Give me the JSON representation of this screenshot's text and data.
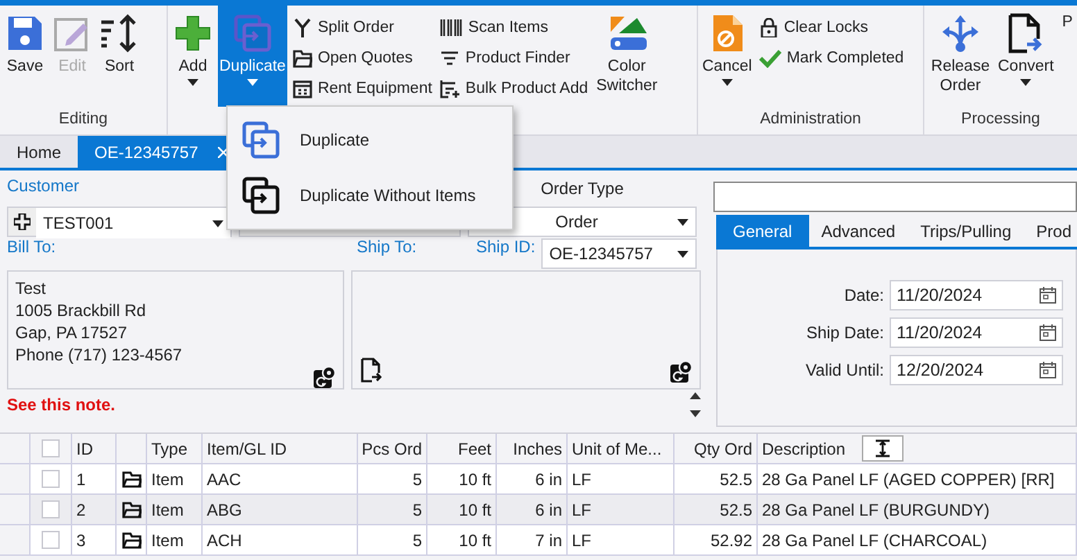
{
  "ribbon": {
    "groups": [
      {
        "label": "Editing",
        "items": [
          {
            "kind": "large",
            "label": "Save",
            "disabled": false,
            "dropdown": false,
            "open": false
          },
          {
            "kind": "large",
            "label": "Edit",
            "disabled": true,
            "dropdown": false,
            "open": false
          },
          {
            "kind": "large",
            "label": "Sort",
            "disabled": false,
            "dropdown": false,
            "open": false
          }
        ]
      },
      {
        "items": [
          {
            "kind": "large",
            "label": "Add",
            "disabled": false,
            "dropdown": true,
            "open": false
          },
          {
            "kind": "large",
            "label": "Duplicate",
            "disabled": false,
            "dropdown": true,
            "open": true
          },
          {
            "kind": "column",
            "items": [
              {
                "label": "Split Order"
              },
              {
                "label": "Open Quotes"
              },
              {
                "label": "Rent Equipment"
              }
            ]
          },
          {
            "kind": "column",
            "items": [
              {
                "label": "Scan Items"
              },
              {
                "label": "Product Finder"
              },
              {
                "label": "Bulk Product Add"
              }
            ]
          },
          {
            "kind": "large",
            "label": "Color Switcher",
            "disabled": false,
            "dropdown": false,
            "open": false
          }
        ]
      },
      {
        "label": "Administration",
        "items": [
          {
            "kind": "large",
            "label": "Cancel",
            "disabled": false,
            "dropdown": true,
            "open": false
          },
          {
            "kind": "column",
            "items": [
              {
                "label": "Clear Locks"
              },
              {
                "label": "Mark Completed"
              }
            ]
          }
        ]
      },
      {
        "label": "Processing",
        "items": [
          {
            "kind": "large",
            "label": "Release Order",
            "disabled": false,
            "dropdown": false,
            "open": false
          },
          {
            "kind": "large",
            "label": "Convert",
            "disabled": false,
            "dropdown": true,
            "open": false
          },
          {
            "kind": "large",
            "label": "P",
            "disabled": false,
            "dropdown": false,
            "open": false
          }
        ]
      }
    ]
  },
  "dropdown_menu": {
    "items": [
      {
        "label": "Duplicate"
      },
      {
        "label": "Duplicate Without Items"
      }
    ]
  },
  "doc_tabs": [
    {
      "label": "Home",
      "selected": false,
      "closable": false
    },
    {
      "label": "OE-12345757",
      "selected": true,
      "closable": true
    }
  ],
  "order": {
    "customer_label": "Customer",
    "customer": "TEST001",
    "order_type_label": "Order Type",
    "order_type": "Order",
    "bill_to_label": "Bill To:",
    "ship_to_label": "Ship To:",
    "ship_id_label": "Ship ID:",
    "ship_id": "OE-12345757",
    "bill_to_lines": [
      "Test",
      "1005 Brackbill Rd",
      "Gap, PA 17527",
      "Phone (717) 123-4567"
    ],
    "note": "See this note."
  },
  "side_panel": {
    "tabs": [
      {
        "label": "General",
        "selected": true
      },
      {
        "label": "Advanced",
        "selected": false
      },
      {
        "label": "Trips/Pulling",
        "selected": false
      },
      {
        "label": "Prod",
        "selected": false
      }
    ],
    "fields": [
      {
        "label": "Date:",
        "value": "11/20/2024"
      },
      {
        "label": "Ship Date:",
        "value": "11/20/2024"
      },
      {
        "label": "Valid Until:",
        "value": "12/20/2024"
      }
    ]
  },
  "table": {
    "select_all_checked": false,
    "columns": [
      {
        "label": "ID"
      },
      {
        "label": "Type"
      },
      {
        "label": "Item/GL ID"
      },
      {
        "label": "Pcs Ord"
      },
      {
        "label": "Feet"
      },
      {
        "label": "Inches"
      },
      {
        "label": "Unit of Me..."
      },
      {
        "label": "Qty Ord"
      },
      {
        "label": "Description"
      }
    ],
    "rows": [
      {
        "checked": false,
        "selected": false,
        "id": "1",
        "type": "Item",
        "item": "AAC",
        "pcs": "5",
        "feet": "10 ft",
        "inches": "6 in",
        "unit": "LF",
        "qty": "52.5",
        "description": "28 Ga Panel LF (AGED COPPER) [RR]"
      },
      {
        "checked": false,
        "selected": true,
        "id": "2",
        "type": "Item",
        "item": "ABG",
        "pcs": "5",
        "feet": "10 ft",
        "inches": "6 in",
        "unit": "LF",
        "qty": "52.5",
        "description": "28 Ga Panel LF (BURGUNDY)"
      },
      {
        "checked": false,
        "selected": false,
        "id": "3",
        "type": "Item",
        "item": "ACH",
        "pcs": "5",
        "feet": "10 ft",
        "inches": "7 in",
        "unit": "LF",
        "qty": "52.92",
        "description": "28 Ga Panel LF (CHARCOAL)"
      }
    ]
  }
}
